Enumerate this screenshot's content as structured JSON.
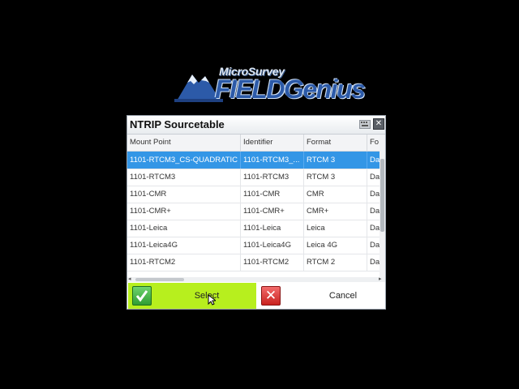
{
  "logo": {
    "brand_small": "MicroSurvey",
    "brand_big": "FIELDGenius",
    "icon": "mountain-logo-icon"
  },
  "dialog": {
    "title": "NTRIP Sourcetable",
    "keyboard_icon": "keyboard-icon",
    "close_icon": "close-icon"
  },
  "table": {
    "columns": [
      "Mount Point",
      "Identifier",
      "Format",
      "Fo"
    ],
    "rows": [
      [
        "1101-RTCM3_CS-QUADRATIC",
        "1101-RTCM3_...",
        "RTCM 3",
        "Da"
      ],
      [
        "1101-RTCM3",
        "1101-RTCM3",
        "RTCM 3",
        "Da"
      ],
      [
        "1101-CMR",
        "1101-CMR",
        "CMR",
        "Da"
      ],
      [
        "1101-CMR+",
        "1101-CMR+",
        "CMR+",
        "Da"
      ],
      [
        "1101-Leica",
        "1101-Leica",
        "Leica",
        "Da"
      ],
      [
        "1101-Leica4G",
        "1101-Leica4G",
        "Leica 4G",
        "Da"
      ],
      [
        "1101-RTCM2",
        "1101-RTCM2",
        "RTCM 2",
        "Da"
      ]
    ],
    "selected_row": 0
  },
  "buttons": {
    "select_label": "Select",
    "cancel_label": "Cancel"
  },
  "colors": {
    "selected_row": "#3396e6",
    "select_button": "#b7ef1e",
    "cancel_icon": "#d62a27",
    "check_icon": "#3fae3f"
  }
}
